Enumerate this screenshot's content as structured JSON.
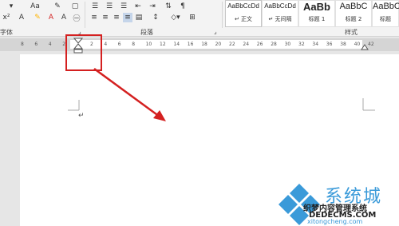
{
  "ribbon": {
    "font_tools": [
      "Aa",
      "A",
      "A"
    ],
    "paragraph_label": "段落",
    "styles_label": "样式",
    "font_label_partial": "字体"
  },
  "styles": [
    {
      "preview": "AaBbCcDd",
      "name": "↵ 正文"
    },
    {
      "preview": "AaBbCcDd",
      "name": "↵ 无间隔"
    },
    {
      "preview": "AaBb",
      "name": "标题 1"
    },
    {
      "preview": "AaBbC",
      "name": "标题 2"
    },
    {
      "preview": "AaBbC",
      "name": "标题"
    }
  ],
  "ruler": {
    "ticks": [
      "8",
      "6",
      "4",
      "2",
      "",
      "2",
      "4",
      "6",
      "8",
      "10",
      "12",
      "14",
      "16",
      "18",
      "20",
      "22",
      "24",
      "26",
      "28",
      "30",
      "32",
      "34",
      "36",
      "38",
      "40",
      "42"
    ]
  },
  "document": {
    "cursor_glyph": "↵"
  },
  "watermark": {
    "line1": "系统城",
    "line2": "织梦内容管理系统",
    "line3": "DEDECMS.COM",
    "line4": "xitongcheng.com"
  },
  "colors": {
    "annotation": "#d42020",
    "accent": "#2b579a"
  }
}
